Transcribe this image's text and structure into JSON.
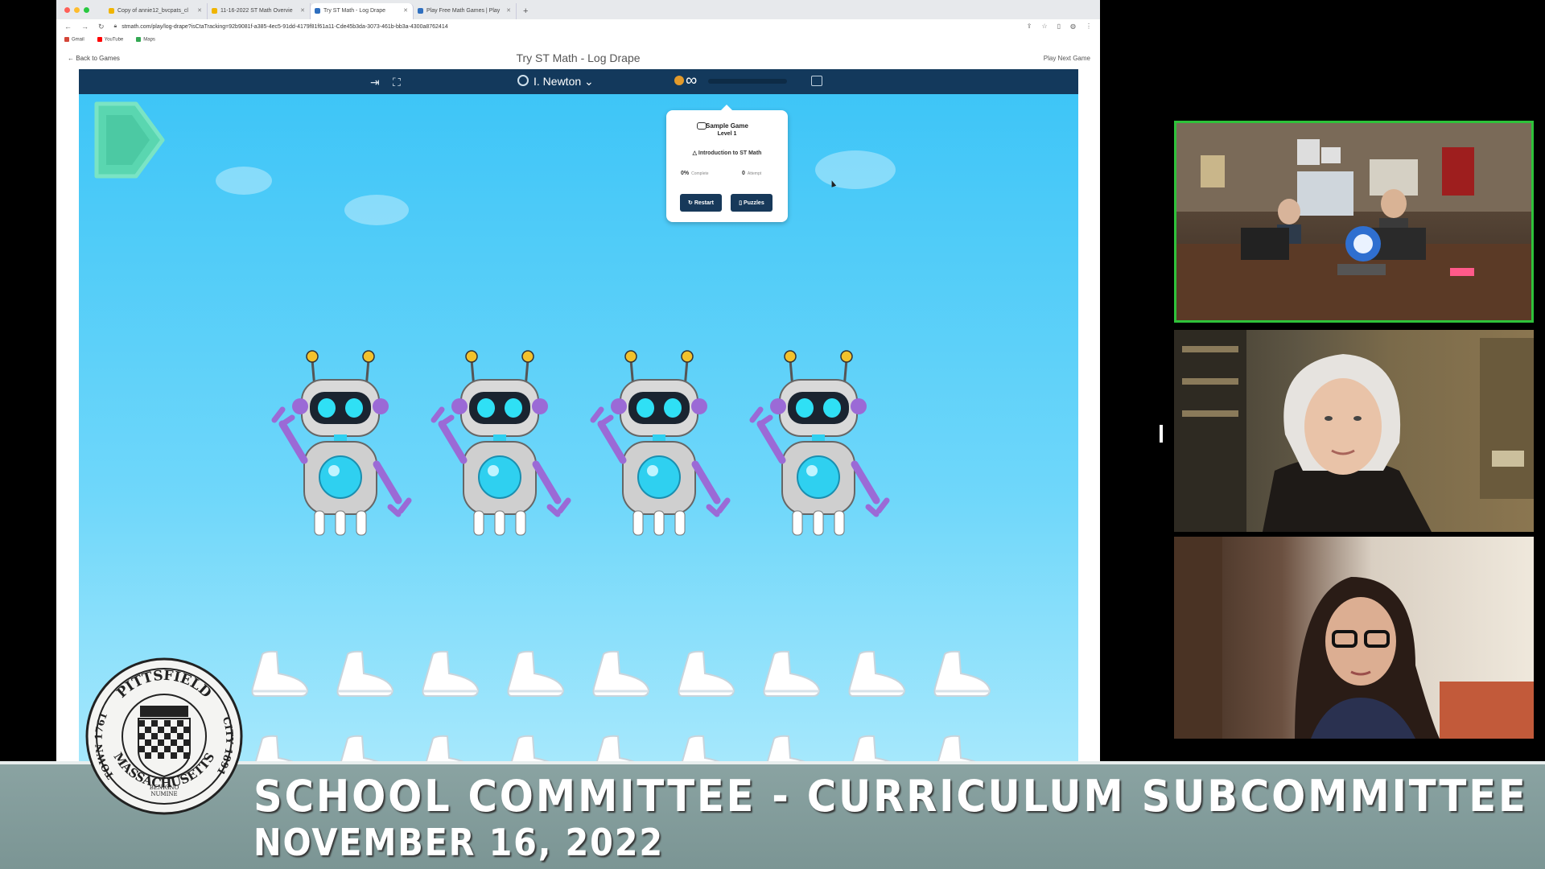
{
  "browser": {
    "tabs": [
      {
        "label": "Copy of annie12_bvcpats_cl"
      },
      {
        "label": "11-16-2022 ST Math Overvie"
      },
      {
        "label": "Try ST Math - Log Drape"
      },
      {
        "label": "Play Free Math Games | Play"
      }
    ],
    "new_tab": "+",
    "url": "stmath.com/play/log-drape?isCtaTracking=92b9081f-a385-4ec5-91dd-4179f81f61a11-Cde45b3da-3073-461b-bb3a-4300a8762414",
    "bookmarks": [
      "Gmail",
      "YouTube",
      "Maps"
    ],
    "colors": {
      "bookmark_gmail": "#d44638",
      "bookmark_youtube": "#ff0000",
      "bookmark_maps": "#34a853"
    }
  },
  "page": {
    "back_link": "Back to Games",
    "title": "Try ST Math - Log Drape",
    "next_link": "Play Next Game"
  },
  "game": {
    "user_name": "I. Newton",
    "progress_fraction": 0.0,
    "popup": {
      "title": "Sample Game",
      "level": "Level 1",
      "intro": "Introduction to ST Math",
      "complete_value": "0%",
      "complete_label": "Complete",
      "attempts_value": "0",
      "attempts_label": "Attempt",
      "restart_label": "Restart",
      "puzzles_label": "Puzzles"
    },
    "robot_count": 4,
    "colors": {
      "sky_top": "#3ec5f7",
      "bar": "#13395c",
      "play_button": "#5ad6b0",
      "robot_accent": "#9b6ad6",
      "robot_core": "#2fd0f0"
    }
  },
  "lower_third": {
    "line1": "SCHOOL COMMITTEE - CURRICULUM SUBCOMMITTEE",
    "line2": "NOVEMBER 16, 2022"
  },
  "seal": {
    "text_top": "PITTSFIELD",
    "text_left": "TOWN 1761",
    "text_right": "CITY 1891",
    "text_bottom": "MASSACHUSETTS",
    "motto_1": "BENIGNO",
    "motto_2": "NUMINE"
  }
}
